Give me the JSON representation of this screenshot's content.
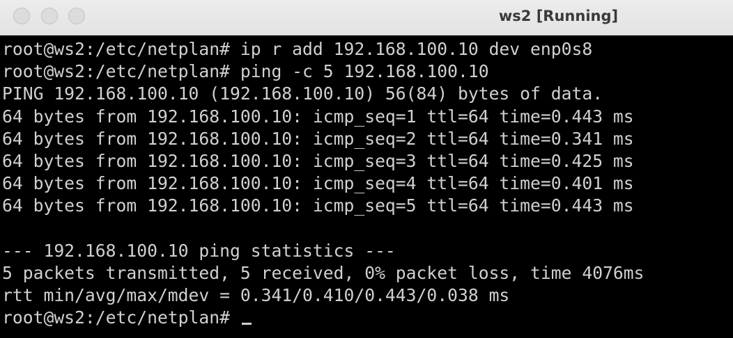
{
  "window": {
    "title": "ws2 [Running]",
    "buttons": [
      "close",
      "minimize",
      "zoom"
    ]
  },
  "terminal": {
    "lines": [
      "root@ws2:/etc/netplan# ip r add 192.168.100.10 dev enp0s8",
      "root@ws2:/etc/netplan# ping -c 5 192.168.100.10",
      "PING 192.168.100.10 (192.168.100.10) 56(84) bytes of data.",
      "64 bytes from 192.168.100.10: icmp_seq=1 ttl=64 time=0.443 ms",
      "64 bytes from 192.168.100.10: icmp_seq=2 ttl=64 time=0.341 ms",
      "64 bytes from 192.168.100.10: icmp_seq=3 ttl=64 time=0.425 ms",
      "64 bytes from 192.168.100.10: icmp_seq=4 ttl=64 time=0.401 ms",
      "64 bytes from 192.168.100.10: icmp_seq=5 ttl=64 time=0.443 ms",
      "",
      "--- 192.168.100.10 ping statistics ---",
      "5 packets transmitted, 5 received, 0% packet loss, time 4076ms",
      "rtt min/avg/max/mdev = 0.341/0.410/0.443/0.038 ms"
    ],
    "prompt": "root@ws2:/etc/netplan# ",
    "input": ""
  },
  "colors": {
    "background": "#000000",
    "foreground": "#d0d0d0",
    "titlebar": "#e8e8e8"
  }
}
